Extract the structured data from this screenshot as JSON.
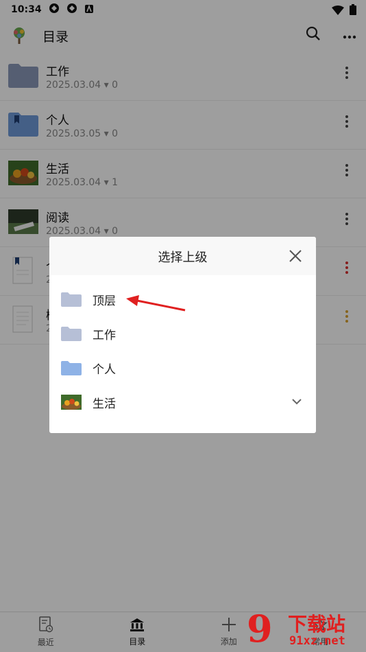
{
  "status_bar": {
    "time": "10:34"
  },
  "app_bar": {
    "title": "目录"
  },
  "folders": [
    {
      "name": "工作",
      "date": "2025.03.04",
      "count": "0"
    },
    {
      "name": "个人",
      "date": "2025.03.05",
      "count": "0"
    },
    {
      "name": "生活",
      "date": "2025.03.04",
      "count": "1"
    },
    {
      "name": "阅读",
      "date": "2025.03.04",
      "count": "0"
    },
    {
      "name": "个",
      "date": "2",
      "count": ""
    },
    {
      "name": "概",
      "date": "2",
      "count": ""
    }
  ],
  "dialog": {
    "title": "选择上级",
    "items": [
      {
        "label": "顶层",
        "icon": "folder-icon"
      },
      {
        "label": "工作",
        "icon": "folder-icon"
      },
      {
        "label": "个人",
        "icon": "folder-icon"
      },
      {
        "label": "生活",
        "icon": "fruit-thumbnail"
      }
    ]
  },
  "bottom_nav": [
    {
      "label": "最近",
      "icon": "document-clock-icon"
    },
    {
      "label": "目录",
      "icon": "bank-icon"
    },
    {
      "label": "添加",
      "icon": "plus-icon"
    },
    {
      "label": "常用",
      "icon": "star-icon"
    }
  ],
  "watermark": {
    "text1": "9",
    "text2": "下载站",
    "text3": "91xz.net"
  },
  "colors": {
    "accent_red": "#e02020",
    "folder_gray": "#8a98b8",
    "folder_blue": "#6e9ad8"
  }
}
